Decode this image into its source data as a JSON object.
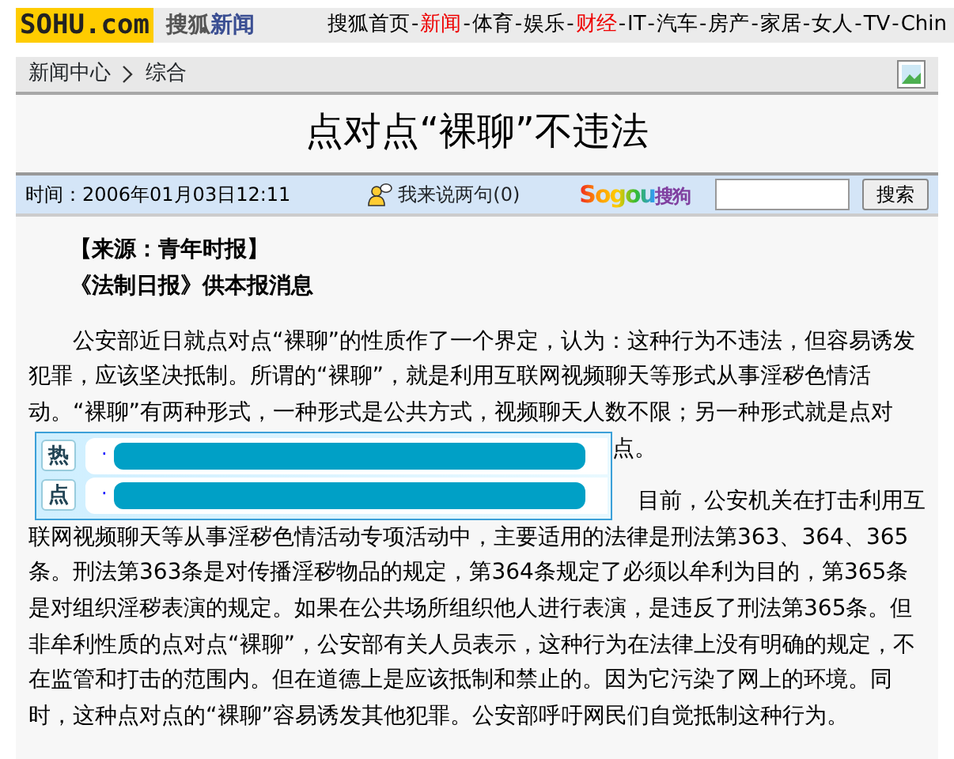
{
  "header": {
    "logo": "SOHU.com",
    "channel": [
      "搜狐",
      "新闻"
    ],
    "nav": [
      {
        "label": "搜狐首页",
        "highlighted": false
      },
      {
        "separator": "-",
        "label": "新闻",
        "highlighted": true
      },
      {
        "separator": "-",
        "label": "体育",
        "highlighted": false
      },
      {
        "separator": "-",
        "label": "娱乐",
        "highlighted": false
      },
      {
        "separator": "-",
        "label": "财经",
        "highlighted": true
      },
      {
        "separator": "-",
        "label": "IT",
        "highlighted": false
      },
      {
        "separator": "-",
        "label": "汽车",
        "highlighted": false
      },
      {
        "separator": "-",
        "label": "房产",
        "highlighted": false
      },
      {
        "separator": "-",
        "label": "家居",
        "highlighted": false
      },
      {
        "separator": "-",
        "label": "女人",
        "highlighted": false
      },
      {
        "separator": "-",
        "label": "TV",
        "highlighted": false
      },
      {
        "separator": "-",
        "label": "Chin",
        "highlighted": false
      }
    ]
  },
  "breadcrumb": [
    "新闻中心",
    "综合"
  ],
  "title": "点对点“裸聊”不违法",
  "info_bar": {
    "time": "时间：2006年01月03日12:11",
    "comments": "我来说两句(0)",
    "search_logo": [
      "Sogou",
      "搜狗"
    ],
    "search_button": "搜索"
  },
  "article": {
    "source": "【来源：青年时报】",
    "byline": "《法制日报》供本报消息",
    "paragraph_1": "公安部近日就点对点“裸聊”的性质作了一个界定，认为：这种行为不违法，但容易诱发犯罪，应该坚决抵制。所谓的“裸聊”，就是利用互联网视频聊天等形式从事淫秽色情活动。“裸聊”有两种形式，一种形式是公共方式，视频聊天人数不限；另一种形式就是点对",
    "beside_box_1": "点。",
    "beside_box_2": "目前，公安机关在打击利用互",
    "paragraph_2": "联网视频聊天等从事淫秽色情活动专项活动中，主要适用的法律是刑法第363、364、365条。刑法第363条是对传播淫秽物品的规定，第364条规定了必须以牟利为目的，第365条是对组织淫秽表演的规定。如果在公共场所组织他人进行表演，是违反了刑法第365条。但非牟利性质的点对点“裸聊”，公安部有关人员表示，这种行为在法律上没有明确的规定，不在监管和打击的范围内。但在道德上是应该抵制和禁止的。因为它污染了网上的环境。同时，这种点对点的“裸聊”容易诱发其他犯罪。公安部呼吁网民们自觉抵制这种行为。"
  },
  "hot_box": [
    {
      "badge": "热",
      "bullet": "·"
    },
    {
      "badge": "点",
      "bullet": "·"
    }
  ]
}
